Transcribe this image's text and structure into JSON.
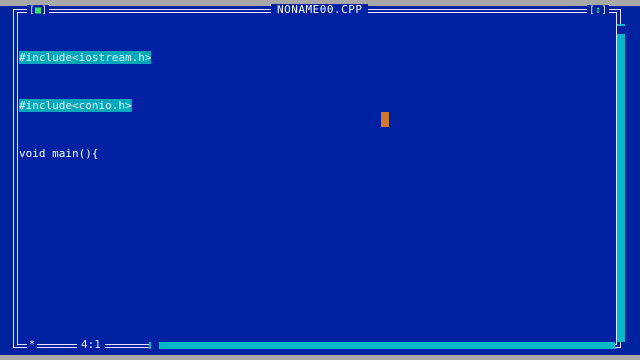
{
  "window": {
    "title": "NONAME00.CPP",
    "close_box": "[",
    "close_dot": "■",
    "close_end": "]",
    "zoom_box_open": "[",
    "zoom_arrows": "↕",
    "zoom_box_close": "]"
  },
  "editor": {
    "lines": [
      "#include<iostream.h>",
      "#include<conio.h>",
      "void main(){"
    ],
    "selected_lines": [
      0,
      1
    ],
    "cursor_position": "4:1",
    "status_marker": "*"
  },
  "colors": {
    "background": "#00229e",
    "selection": "#00a8b8",
    "cursor": "#d07a30",
    "frame": "#e6e6ff"
  }
}
